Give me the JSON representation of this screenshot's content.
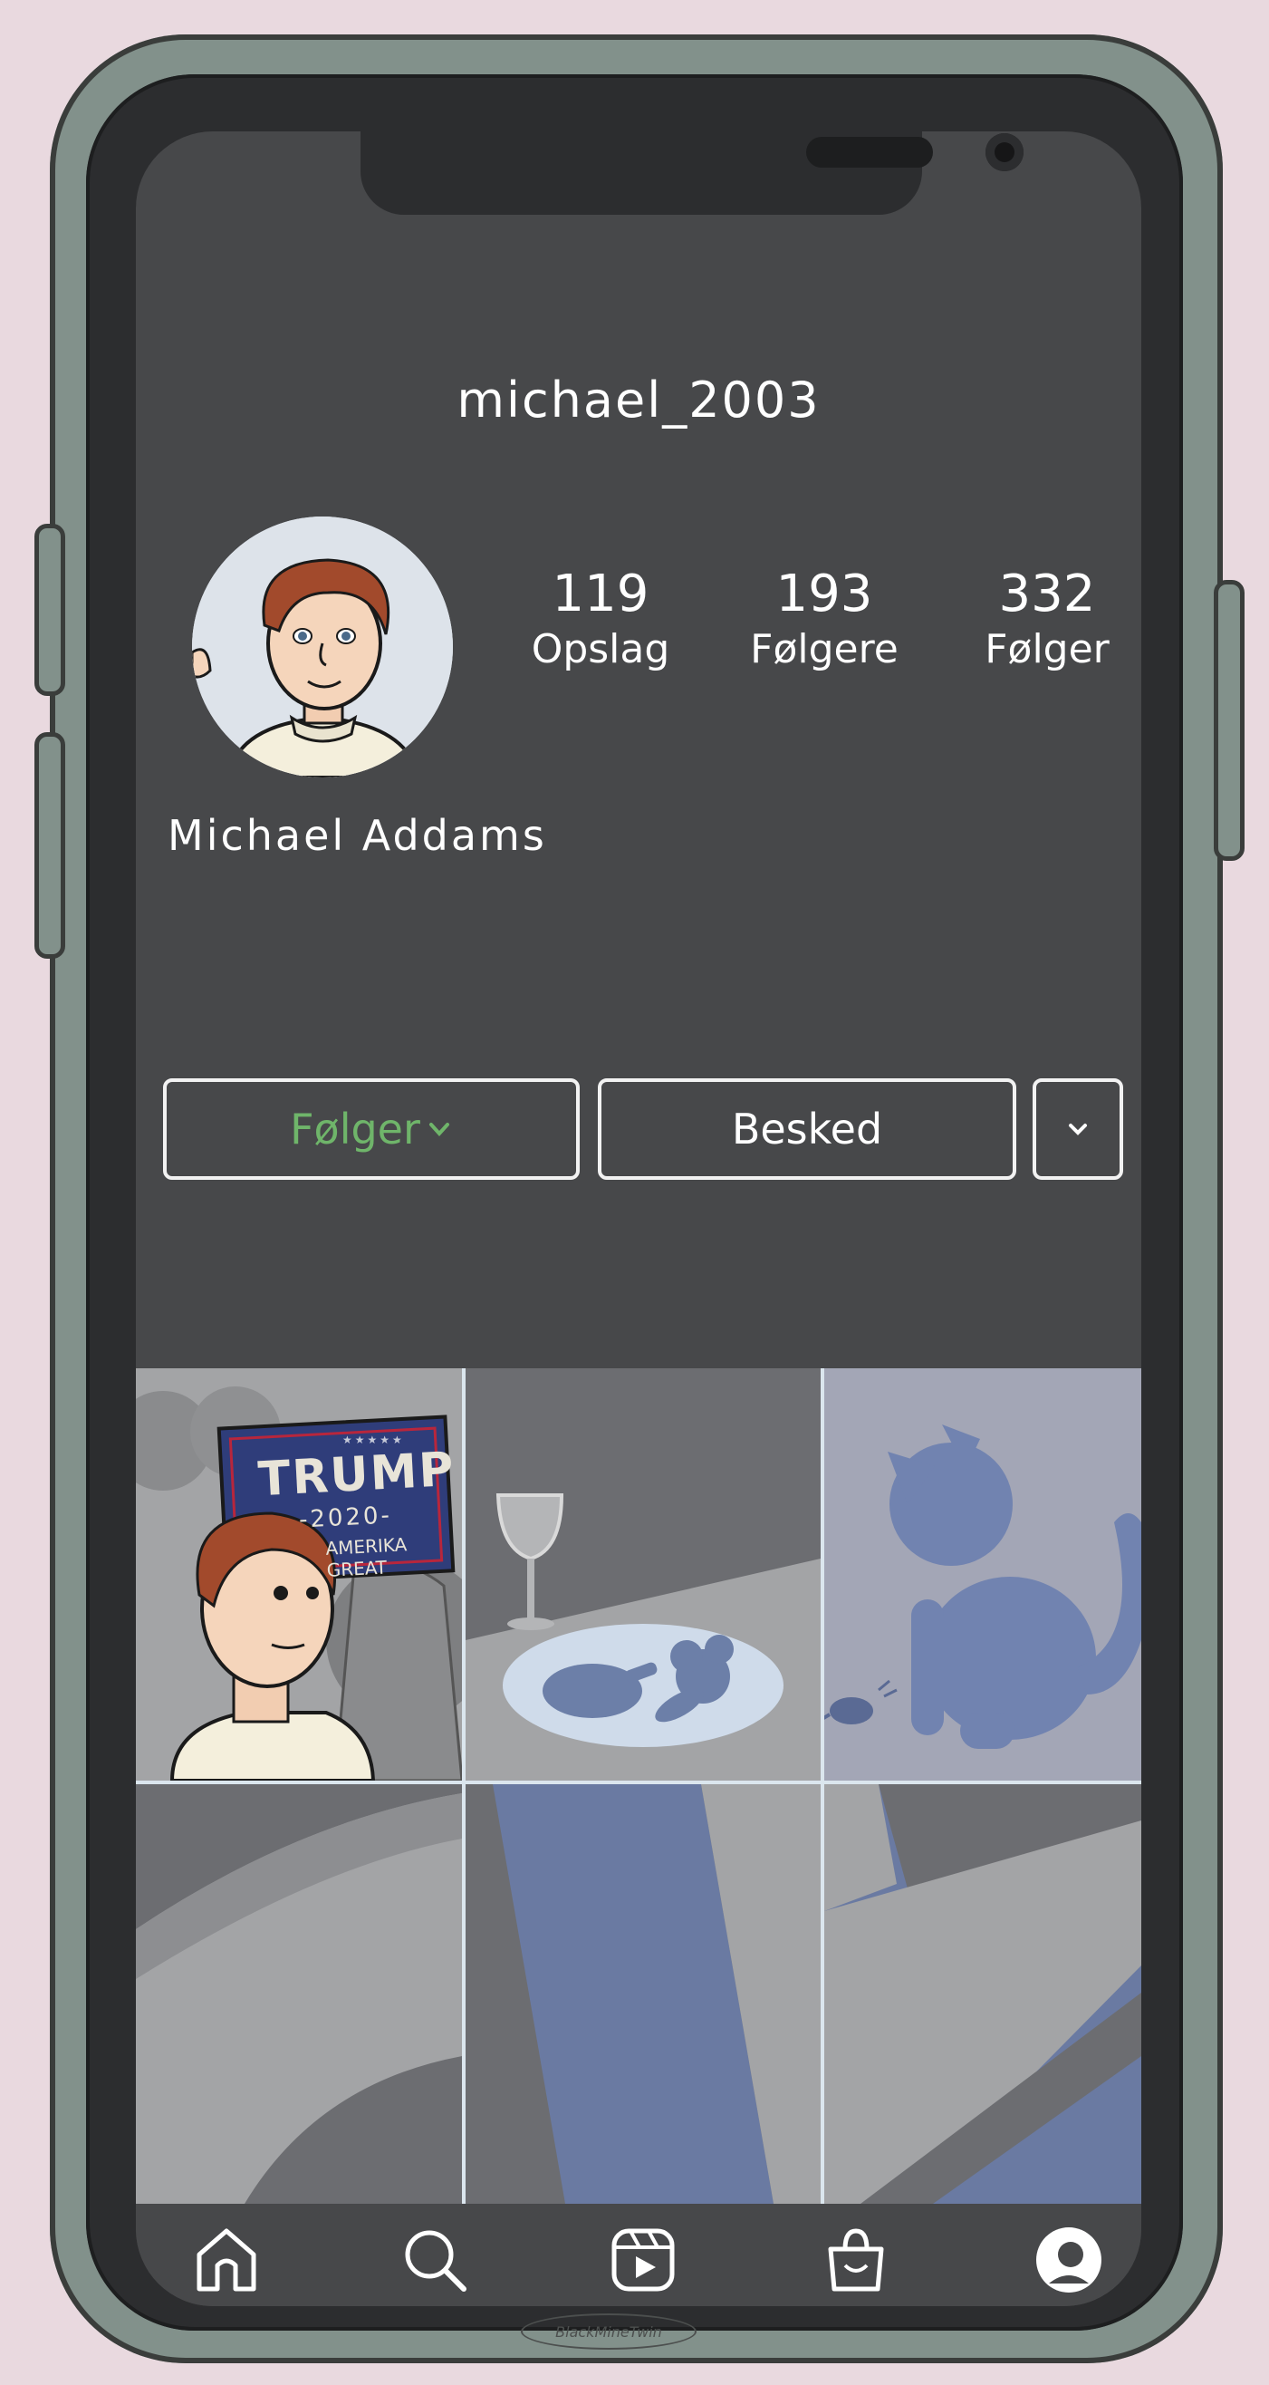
{
  "profile": {
    "username": "michael_2003",
    "full_name": "Michael Addams",
    "stats": [
      {
        "value": "119",
        "label": "Opslag"
      },
      {
        "value": "193",
        "label": "Følgere"
      },
      {
        "value": "332",
        "label": "Følger"
      }
    ]
  },
  "actions": {
    "follow_label": "Følger",
    "message_label": "Besked"
  },
  "posts": {
    "sign_title": "TRUMP",
    "sign_year": "-2020-",
    "sign_slogan": "AMERIKA GREAT",
    "sign_stars": "★★★★★"
  },
  "nav": [
    "home-icon",
    "search-icon",
    "reels-icon",
    "shop-icon",
    "profile-avatar-icon"
  ],
  "watermark": "BlackMineTwin",
  "colors": {
    "background": "#e9d9df",
    "phone_frame": "#82918b",
    "screen": "#47484a",
    "following_green": "#6fb56a"
  }
}
